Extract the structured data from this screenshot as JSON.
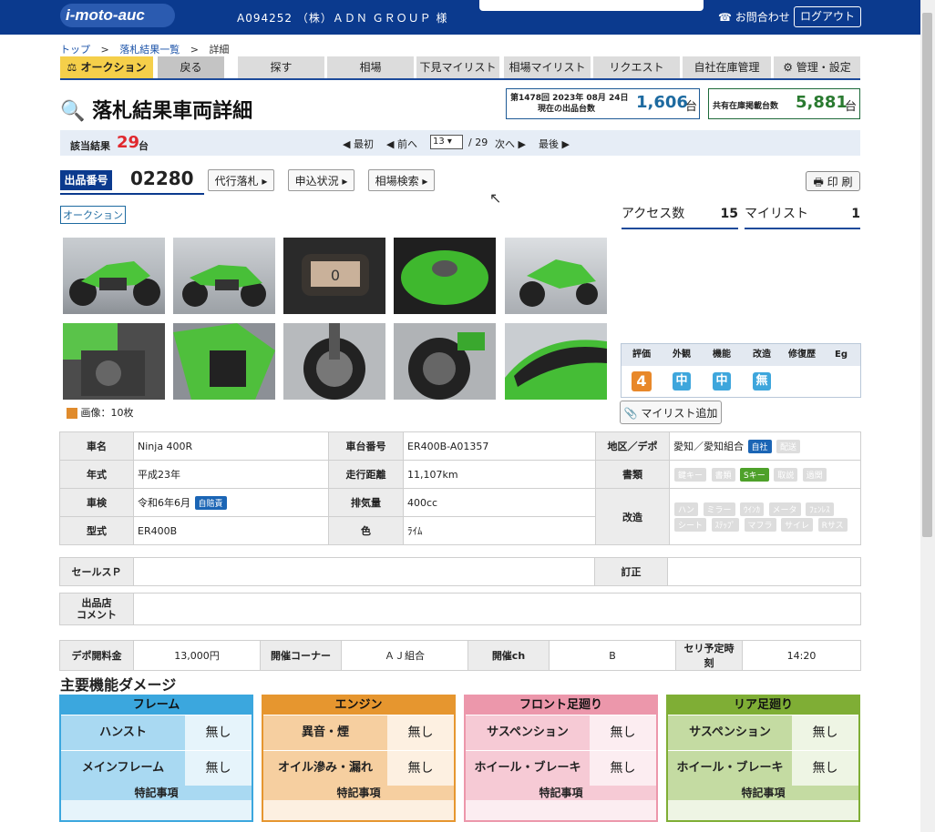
{
  "header": {
    "logo": "i-moto-auc",
    "account": "A094252 （株）ＡＤＮ ＧＲＯＵＰ 様",
    "contact": "お問合わせ",
    "logout": "ログアウト"
  },
  "breadcrumb": {
    "top": "トップ",
    "list": "落札結果一覧",
    "current": "詳細",
    "sep": ">"
  },
  "tabs": {
    "auction": "オークション",
    "back": "戻る",
    "search": "探す",
    "market": "相場",
    "preview": "下見マイリスト",
    "market_mylist": "相場マイリスト",
    "request": "リクエスト",
    "stock": "自社在庫管理",
    "admin": "管理・設定"
  },
  "page_title": "落札結果車両詳細",
  "stats": {
    "session": "第1478回 2023年 08月 24日",
    "current_label": "現在の出品台数",
    "current_count": "1,606",
    "unit": "台",
    "shared_label": "共有在庫掲載台数",
    "shared_count": "5,881"
  },
  "pager": {
    "hits_label": "該当結果",
    "hits": "29",
    "unit": "台",
    "first": "◀ 最初",
    "prev": "◀ 前へ",
    "page": "13",
    "total": "/ 29",
    "next": "次へ ▶",
    "last": "最後 ▶"
  },
  "lot": {
    "number_label": "出品番号",
    "number": "02280",
    "proxy_btn": "代行落札 ▸",
    "apply_btn": "申込状況 ▸",
    "market_btn": "相場検索 ▸",
    "print_btn": "印 刷",
    "tag": "オークション",
    "images": "画像：10枚"
  },
  "access": {
    "access_label": "アクセス数",
    "access": "15",
    "mylist_label": "マイリスト",
    "mylist": "1"
  },
  "ratings": {
    "headers": [
      "評価",
      "外観",
      "機能",
      "改造",
      "修復歴",
      "Eg"
    ],
    "values": [
      "4",
      "中",
      "中",
      "無",
      "",
      ""
    ]
  },
  "mylist_add": "マイリスト追加",
  "details": {
    "name_label": "車名",
    "name": "Ninja 400R",
    "frame_label": "車台番号",
    "frame": "ER400B-A01357",
    "region_label": "地区／デポ",
    "region": "愛知／愛知組合",
    "own_badge": "自社",
    "ship_badge": "配送",
    "year_label": "年式",
    "year": "平成23年",
    "mileage_label": "走行距離",
    "mileage": "11,107km",
    "docs_label": "書類",
    "docs_badges": [
      "鍵キー",
      "書類",
      "Sキー",
      "取説",
      "過関"
    ],
    "inspect_label": "車検",
    "inspect": "令和6年6月",
    "jibaiseki": "自賠責",
    "disp_label": "排気量",
    "disp": "400cc",
    "mod_label": "改造",
    "mod_badges": [
      "ハン",
      "ミラー",
      "ｳｲﾝｶ",
      "メータ",
      "ﾌｪﾝﾚｽ",
      "シート",
      "ｽﾃｯﾌﾟ",
      "マフラ",
      "サイレ",
      "Rサス"
    ],
    "model_label": "型式",
    "model": "ER400B",
    "color_label": "色",
    "color": "ﾗｲﾑ"
  },
  "sales": {
    "sales_label": "セールスＰ",
    "fix_label": "訂正",
    "comment_label_1": "出品店",
    "comment_label_2": "コメント"
  },
  "info": {
    "fee_label": "デポ開料金",
    "fee": "13,000円",
    "corner_label": "開催コーナー",
    "corner": "ＡＪ組合",
    "ch_label": "開催ch",
    "ch": "B",
    "time_label": "セリ予定時刻",
    "time": "14:20"
  },
  "damage": {
    "title": "主要機能ダメージ",
    "note_label": "特記事項",
    "panels": [
      {
        "title": "フレーム",
        "rows": [
          {
            "k": "ハンスト",
            "v": "無し"
          },
          {
            "k": "メインフレーム",
            "v": "無し"
          }
        ]
      },
      {
        "title": "エンジン",
        "rows": [
          {
            "k": "異音・煙",
            "v": "無し"
          },
          {
            "k": "オイル滲み・漏れ",
            "v": "無し"
          }
        ]
      },
      {
        "title": "フロント足廻り",
        "rows": [
          {
            "k": "サスペンション",
            "v": "無し"
          },
          {
            "k": "ホイール・ブレーキ",
            "v": "無し"
          }
        ]
      },
      {
        "title": "リア足廻り",
        "rows": [
          {
            "k": "サスペンション",
            "v": "無し"
          },
          {
            "k": "ホイール・ブレーキ",
            "v": "無し"
          }
        ]
      }
    ]
  },
  "colors": {
    "brand": "#0b3a8e",
    "accent": "#1d6aa0",
    "red": "#e0282e",
    "green": "#2a7a30"
  }
}
